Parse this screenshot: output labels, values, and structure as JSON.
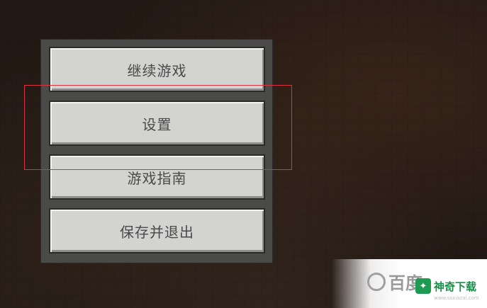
{
  "menu": {
    "buttons": [
      {
        "label": "继续游戏"
      },
      {
        "label": "设置"
      },
      {
        "label": "游戏指南"
      },
      {
        "label": "保存并退出"
      }
    ]
  },
  "annotation": {
    "highlight_color": "#d8343f",
    "highlighted_item": "设置"
  },
  "watermark": {
    "baidu_text": "百度",
    "baidu_icon": "baidu-paw-icon",
    "brand_text": "神奇下载",
    "brand_icon": "download-leaf-icon",
    "url": "www.ssxiazai.com"
  },
  "colors": {
    "button_face": "#d3d3d1",
    "panel": "#4a4a48",
    "background": "#231914"
  }
}
